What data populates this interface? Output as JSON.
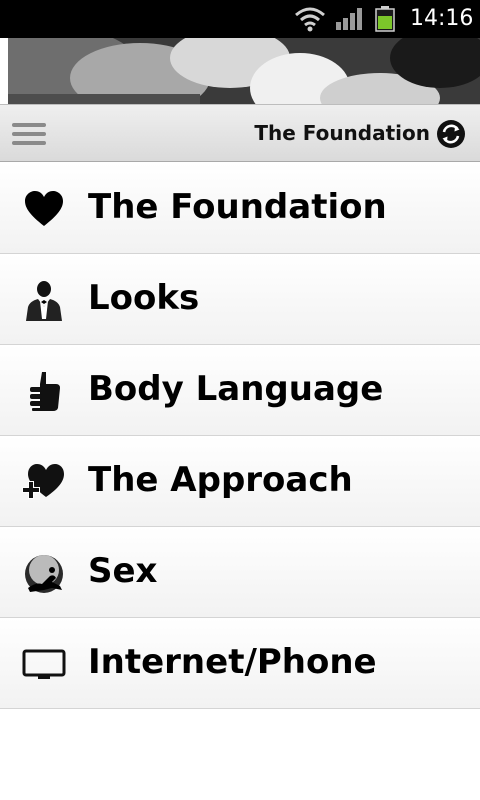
{
  "status_bar": {
    "time": "14:16",
    "icons": [
      "wifi-icon",
      "signal-icon",
      "battery-icon"
    ],
    "battery_color": "#7cc62a"
  },
  "action_bar": {
    "title": "The Foundation",
    "menu_icon": "menu-icon",
    "refresh_icon": "refresh-icon"
  },
  "menu": {
    "items": [
      {
        "label": "The Foundation",
        "icon": "heart-icon"
      },
      {
        "label": "Looks",
        "icon": "person-suit-icon"
      },
      {
        "label": "Body Language",
        "icon": "thumbs-up-icon"
      },
      {
        "label": "The Approach",
        "icon": "heart-plus-icon"
      },
      {
        "label": "Sex",
        "icon": "silhouette-icon"
      },
      {
        "label": "Internet/Phone",
        "icon": "monitor-icon"
      }
    ]
  }
}
